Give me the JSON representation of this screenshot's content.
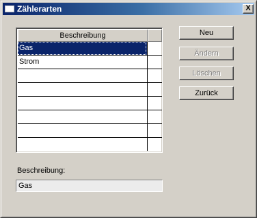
{
  "window": {
    "title": "Zählerarten",
    "close_label": "X"
  },
  "grid": {
    "header": "Beschreibung",
    "rows": [
      "Gas",
      "Strom",
      "",
      "",
      "",
      "",
      ""
    ],
    "selected_index": 0
  },
  "buttons": {
    "neu": "Neu",
    "aendern": "Ändern",
    "loeschen": "Löschen",
    "zurueck": "Zurück"
  },
  "description": {
    "label": "Beschreibung:",
    "value": "Gas"
  },
  "colors": {
    "selection": "#0a246a",
    "face": "#d4d0c8",
    "title_start": "#0a246a",
    "title_end": "#a6caf0"
  }
}
